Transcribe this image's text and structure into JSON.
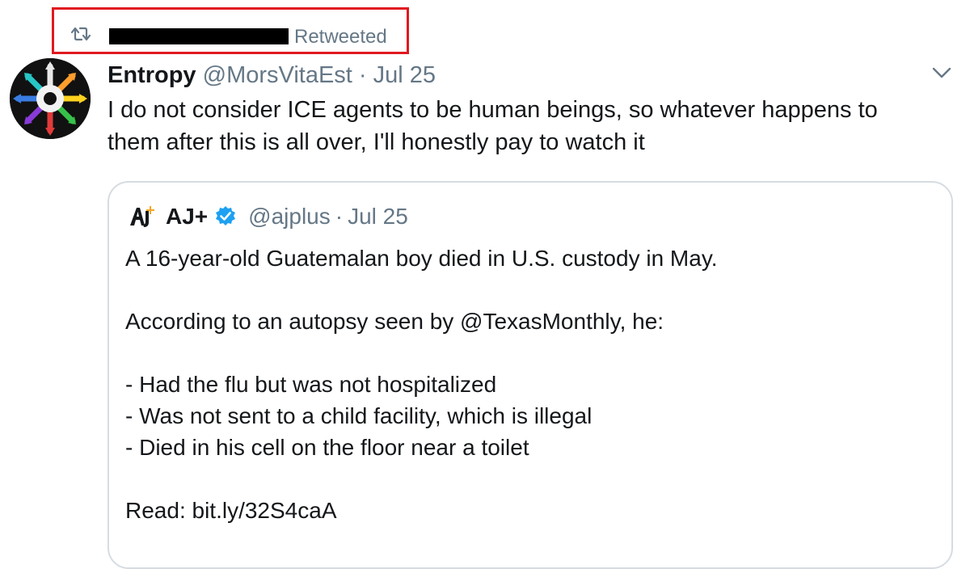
{
  "retweet": {
    "label": "Retweeted",
    "icon": "retweet-icon",
    "redacted_name": true
  },
  "tweet": {
    "author_name": "Entropy",
    "author_handle": "@MorsVitaEst",
    "separator": "·",
    "date": "Jul 25",
    "text_line1": "I do not consider ICE agents to be human beings, so whatever happens to",
    "text_line2": "them after this is all over, I'll honestly pay to watch it",
    "menu_icon": "chevron-down-icon"
  },
  "quote": {
    "author_name": "AJ+",
    "author_handle": "@ajplus",
    "separator": "·",
    "date": "Jul 25",
    "verified": true,
    "line1": "A 16-year-old Guatemalan boy died in U.S. custody in May.",
    "line2": "According to an autopsy seen by @TexasMonthly, he:",
    "line3": "- Had the flu but was not hospitalized",
    "line4": "- Was not sent to a child facility, which is illegal",
    "line5": "- Died in his cell on the floor near a toilet",
    "line6": "Read: bit.ly/32S4caA"
  },
  "colors": {
    "highlight_border": "#e0191f",
    "secondary_text": "#657786",
    "primary_text": "#14171a",
    "verified_blue": "#1da1f2",
    "card_border": "#d6dce1"
  }
}
